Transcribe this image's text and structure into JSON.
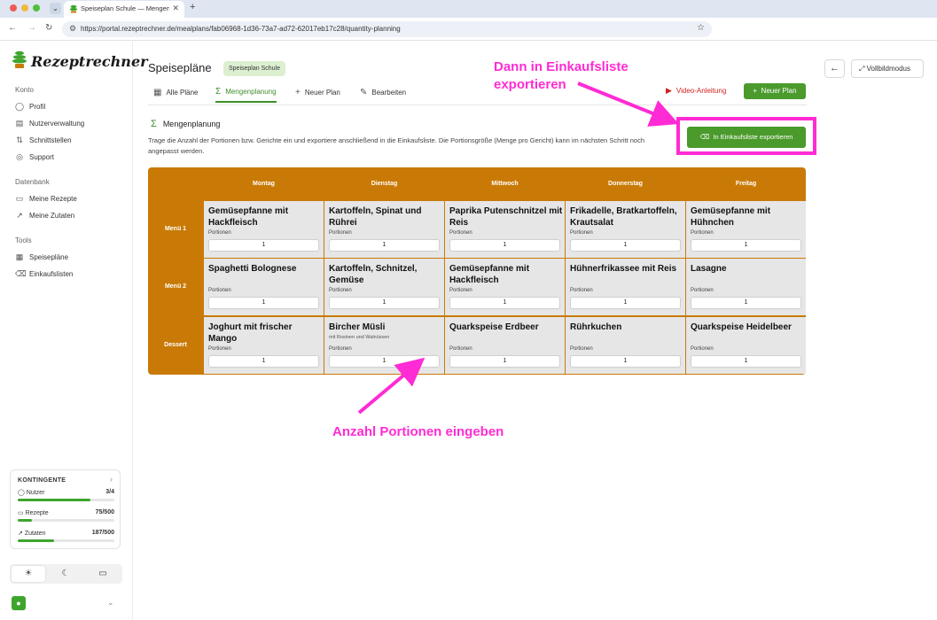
{
  "browser": {
    "tab_title": "Speiseplan Schule — Mengen",
    "url": "https://portal.rezeptrechner.de/mealplans/fab06968-1d36-73a7-ad72-62017eb17c28/quantity-planning"
  },
  "sidebar": {
    "logo_text": "Rezeptrechner",
    "sections": [
      {
        "title": "Konto",
        "items": [
          {
            "label": "Profil",
            "icon": "user-icon"
          },
          {
            "label": "Nutzerverwaltung",
            "icon": "users-icon"
          },
          {
            "label": "Schnittstellen",
            "icon": "plug-icon"
          },
          {
            "label": "Support",
            "icon": "lifebuoy-icon"
          }
        ]
      },
      {
        "title": "Datenbank",
        "items": [
          {
            "label": "Meine Rezepte",
            "icon": "book-icon"
          },
          {
            "label": "Meine Zutaten",
            "icon": "carrot-icon"
          }
        ]
      },
      {
        "title": "Tools",
        "items": [
          {
            "label": "Speisepläne",
            "icon": "calendar-icon"
          },
          {
            "label": "Einkaufslisten",
            "icon": "basket-icon"
          }
        ]
      }
    ],
    "quota": {
      "title": "KONTINGENTE",
      "rows": [
        {
          "label": "Nutzer",
          "value": "3/4",
          "fraction": 0.75
        },
        {
          "label": "Rezepte",
          "value": "75/500",
          "fraction": 0.15
        },
        {
          "label": "Zutaten",
          "value": "187/500",
          "fraction": 0.374
        }
      ]
    },
    "theme_options": [
      "light",
      "dark",
      "system"
    ],
    "theme_selected": "light"
  },
  "header": {
    "title": "Speisepläne",
    "badge": "Speiseplan Schule",
    "tabs": [
      {
        "label": "Alle Pläne",
        "icon": "calendar-icon",
        "active": false
      },
      {
        "label": "Mengenplanung",
        "icon": "sigma-icon",
        "active": true
      },
      {
        "label": "Neuer Plan",
        "icon": "plus-icon",
        "active": false
      },
      {
        "label": "Bearbeiten",
        "icon": "pencil-icon",
        "active": false
      }
    ],
    "video_link": "Video-Anleitung",
    "new_plan_button": "Neuer Plan",
    "fullscreen_button": "Vollbildmodus"
  },
  "section": {
    "title": "Mengenplanung",
    "description": "Trage die Anzahl der Portionen bzw. Gerichte ein und exportiere anschließend in die Einkaufsliste. Die Portionsgröße (Menge pro Gericht) kann im nächsten Schritt noch angepasst werden.",
    "export_button": "In Einkaufsliste exportieren"
  },
  "grid": {
    "days": [
      "Montag",
      "Dienstag",
      "Mittwoch",
      "Donnerstag",
      "Freitag"
    ],
    "portion_label": "Portionen",
    "rows": [
      {
        "label": "Menü 1",
        "cells": [
          {
            "name": "Gemüsepfanne mit Hackfleisch",
            "sub": "",
            "portions": "1"
          },
          {
            "name": "Kartoffeln, Spinat und Rührei",
            "sub": "",
            "portions": "1"
          },
          {
            "name": "Paprika Putenschnitzel mit Reis",
            "sub": "",
            "portions": "1"
          },
          {
            "name": "Frikadelle, Bratkartoffeln, Krautsalat",
            "sub": "",
            "portions": "1"
          },
          {
            "name": "Gemüsepfanne mit Hühnchen",
            "sub": "",
            "portions": "1"
          }
        ]
      },
      {
        "label": "Menü 2",
        "cells": [
          {
            "name": "Spaghetti Bolognese",
            "sub": "",
            "portions": "1"
          },
          {
            "name": "Kartoffeln, Schnitzel, Gemüse",
            "sub": "",
            "portions": "1"
          },
          {
            "name": "Gemüsepfanne mit Hackfleisch",
            "sub": "",
            "portions": "1"
          },
          {
            "name": "Hühnerfrikassee mit Reis",
            "sub": "",
            "portions": "1"
          },
          {
            "name": "Lasagne",
            "sub": "",
            "portions": "1"
          }
        ]
      },
      {
        "label": "Dessert",
        "cells": [
          {
            "name": "Joghurt mit frischer Mango",
            "sub": "",
            "portions": "1"
          },
          {
            "name": "Bircher Müsli",
            "sub": "mit Rosinen und Walnüssen",
            "portions": "1"
          },
          {
            "name": "Quarkspeise Erdbeer",
            "sub": "",
            "portions": "1"
          },
          {
            "name": "Rührkuchen",
            "sub": "",
            "portions": "1"
          },
          {
            "name": "Quarkspeise Heidelbeer",
            "sub": "",
            "portions": "1"
          }
        ]
      }
    ]
  },
  "annotations": {
    "top": "Dann in Einkaufsliste exportieren",
    "bottom": "Anzahl Portionen eingeben"
  },
  "colors": {
    "brand_green": "#4a9a2c",
    "grid_header": "#c97a06",
    "annotation": "#ff2bd4",
    "video_red": "#d22222"
  }
}
